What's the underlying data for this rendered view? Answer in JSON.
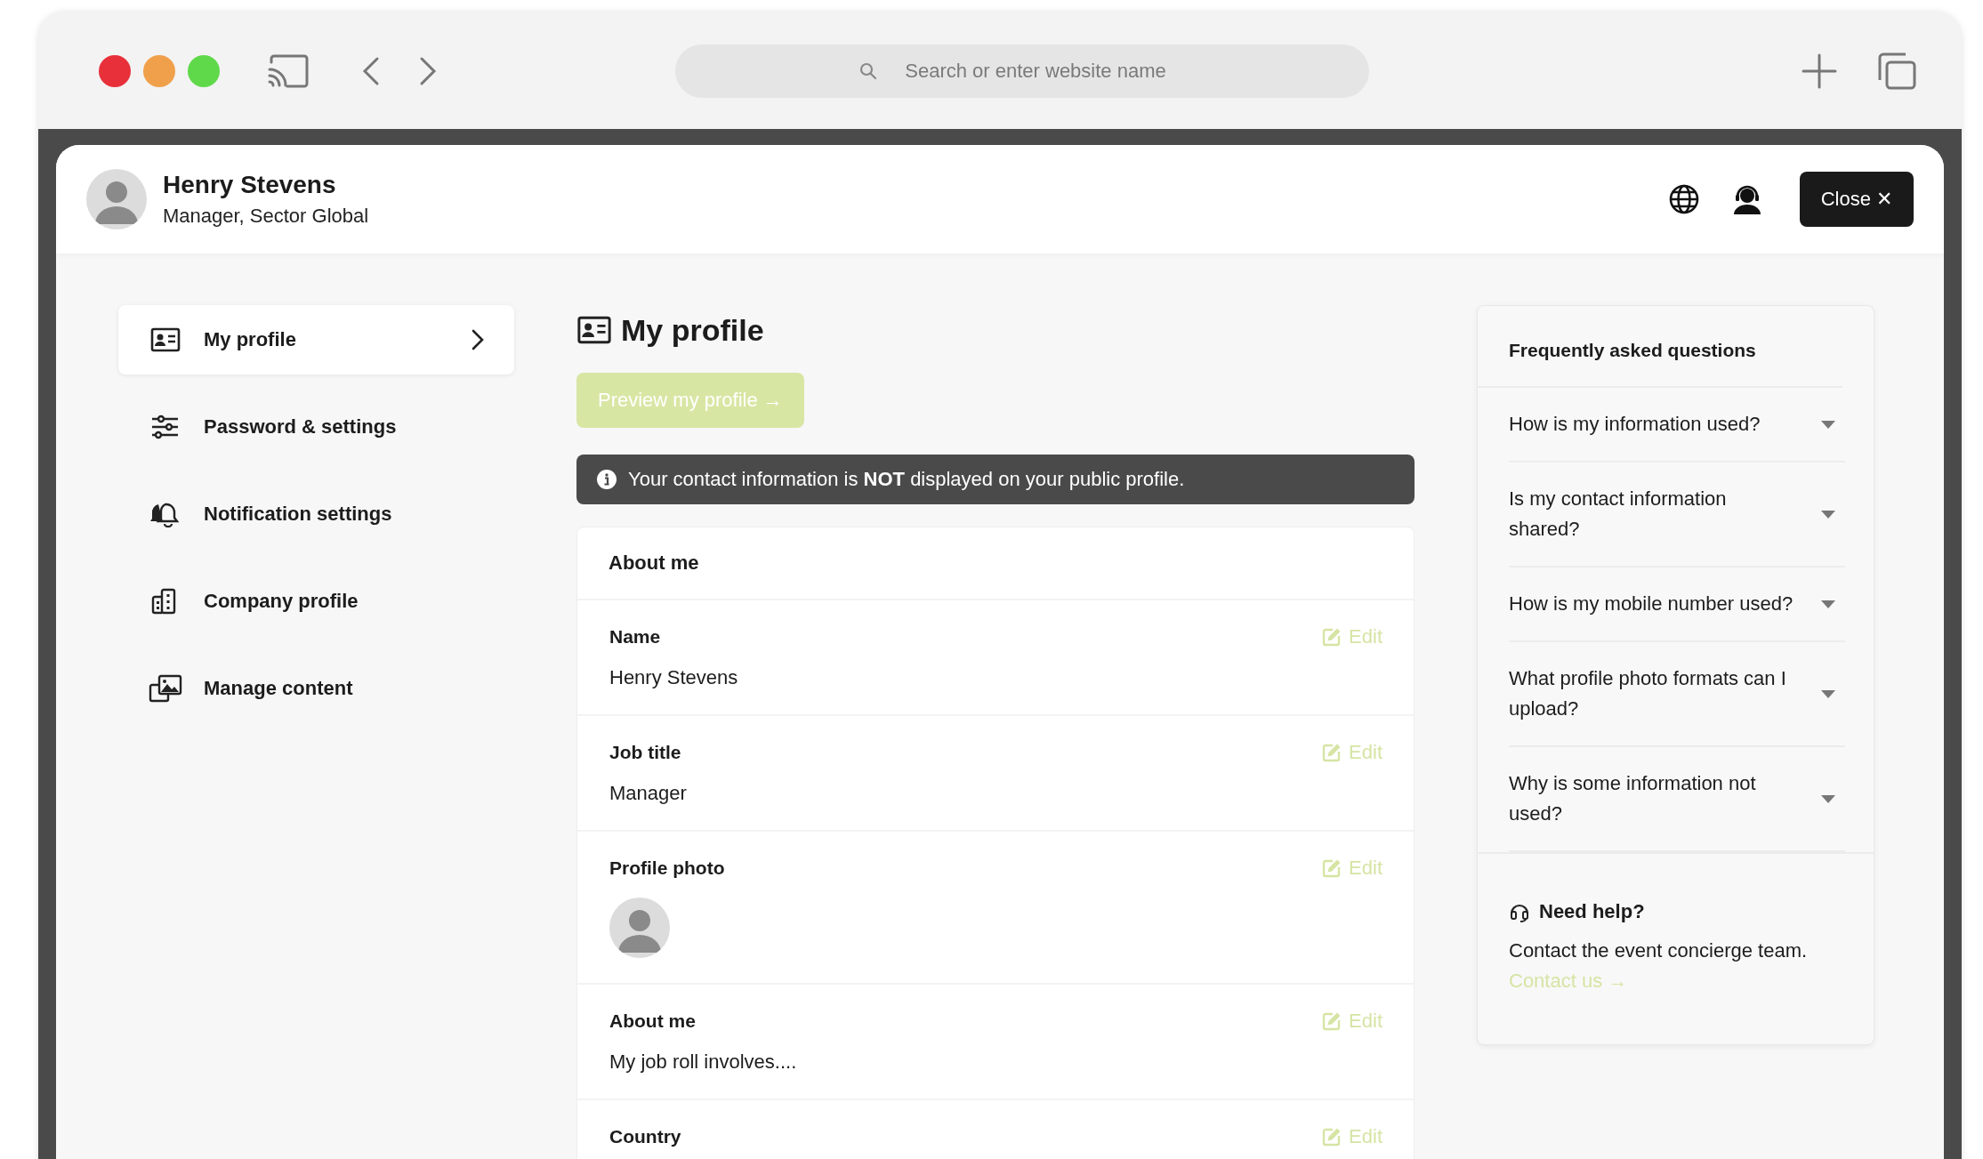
{
  "browser": {
    "search_placeholder": "Search or enter website name"
  },
  "header": {
    "name": "Henry Stevens",
    "subtitle": "Manager, Sector Global",
    "close_label": "Close ✕"
  },
  "sidebar": {
    "items": [
      {
        "label": "My profile",
        "selected": true
      },
      {
        "label": "Password & settings",
        "selected": false
      },
      {
        "label": "Notification settings",
        "selected": false
      },
      {
        "label": "Company profile",
        "selected": false
      },
      {
        "label": "Manage content",
        "selected": false
      }
    ]
  },
  "main": {
    "title": "My profile",
    "preview_button": "Preview my profile →",
    "notice": "Your contact information is **NOT** displayed on your public profile.",
    "card_title": "About me",
    "rows": [
      {
        "kind": "text",
        "label": "Name",
        "value": "Henry Stevens",
        "edit": "Edit"
      },
      {
        "kind": "text",
        "label": "Job title",
        "value": "Manager",
        "edit": "Edit"
      },
      {
        "kind": "photo",
        "label": "Profile photo",
        "edit": "Edit"
      },
      {
        "kind": "text",
        "label": "About me",
        "value": "My job roll involves....",
        "edit": "Edit"
      },
      {
        "kind": "text",
        "label": "Country",
        "edit": "Edit"
      }
    ]
  },
  "faq": {
    "title": "Frequently asked questions",
    "items": [
      {
        "question": "How is my information used?",
        "expanded": false
      },
      {
        "question": "Is my contact information shared?",
        "expanded": false
      },
      {
        "question": "How is my mobile number used?",
        "expanded": false
      },
      {
        "question": "What profile photo formats can I upload?",
        "expanded": false
      },
      {
        "question": "Why is some information not used?",
        "expanded": false
      }
    ],
    "help_title": "Need help?",
    "help_text": "Contact the event concierge team.",
    "help_link": "Contact us →"
  }
}
